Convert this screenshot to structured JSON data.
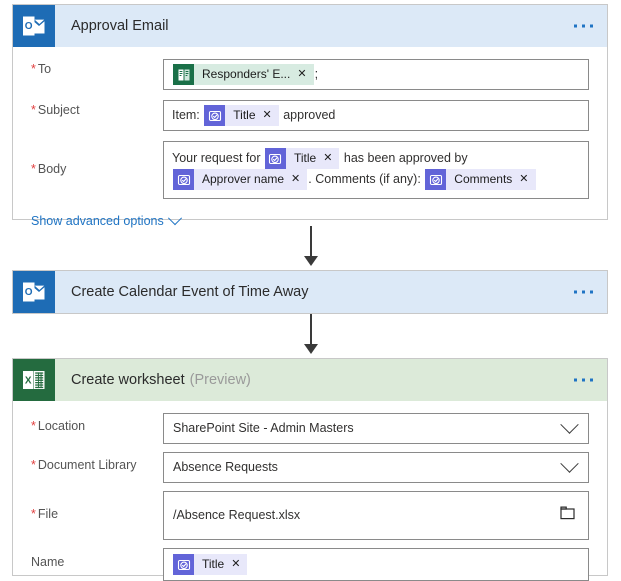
{
  "cards": [
    {
      "id": "approval-email",
      "icon": "outlook-icon",
      "title": "Approval Email",
      "preview": "",
      "menu": "more-options",
      "fields": [
        {
          "label": "To",
          "required": true,
          "parts": [
            {
              "kind": "token",
              "theme": "green",
              "icon": "forms-icon",
              "label": "Responders' E...",
              "remove": "✕"
            },
            {
              "kind": "text",
              "text": ";"
            }
          ]
        },
        {
          "label": "Subject",
          "required": true,
          "parts": [
            {
              "kind": "text",
              "text": "Item:"
            },
            {
              "kind": "token",
              "theme": "purple",
              "icon": "approvals-icon",
              "label": "Title",
              "remove": "✕"
            },
            {
              "kind": "text",
              "text": "approved"
            }
          ]
        },
        {
          "label": "Body",
          "required": true,
          "parts": [
            {
              "kind": "text",
              "text": "Your request for"
            },
            {
              "kind": "token",
              "theme": "purple",
              "icon": "approvals-icon",
              "label": "Title",
              "remove": "✕"
            },
            {
              "kind": "text",
              "text": "has been approved by"
            },
            {
              "kind": "token",
              "theme": "purple",
              "icon": "approvals-icon",
              "label": "Approver name",
              "remove": "✕"
            },
            {
              "kind": "text",
              "text": ". Comments (if any):"
            },
            {
              "kind": "token",
              "theme": "purple",
              "icon": "approvals-icon",
              "label": "Comments",
              "remove": "✕"
            }
          ]
        }
      ],
      "advanced_link": "Show advanced options"
    },
    {
      "id": "create-calendar-event",
      "icon": "outlook-icon",
      "title": "Create Calendar Event of Time Away",
      "preview": "",
      "menu": "more-options"
    },
    {
      "id": "create-worksheet",
      "icon": "excel-icon",
      "title": "Create worksheet",
      "preview": "(Preview)",
      "menu": "more-options",
      "fields": [
        {
          "label": "Location",
          "required": true,
          "value": "SharePoint Site - Admin Masters",
          "control": "dropdown"
        },
        {
          "label": "Document Library",
          "required": true,
          "value": "Absence Requests",
          "control": "dropdown"
        },
        {
          "label": "File",
          "required": true,
          "value": "/Absence Request.xlsx",
          "control": "folder-picker"
        },
        {
          "label": "Name",
          "required": false,
          "control": "tokens",
          "parts": [
            {
              "kind": "token",
              "theme": "purple",
              "icon": "approvals-icon",
              "label": "Title",
              "remove": "✕"
            }
          ]
        }
      ]
    }
  ],
  "colors": {
    "outlook_header": "#dce9f7",
    "outlook_icon": "#1e6cb5",
    "excel_header": "#dcead9",
    "excel_icon": "#246b3f",
    "token_purple": "#6264d8",
    "token_purple_bg": "#e8e8fa",
    "token_green": "#1a7048",
    "token_green_bg": "#d7ebe1",
    "link_blue": "#1f74c4",
    "required_red": "#e03e3e"
  }
}
